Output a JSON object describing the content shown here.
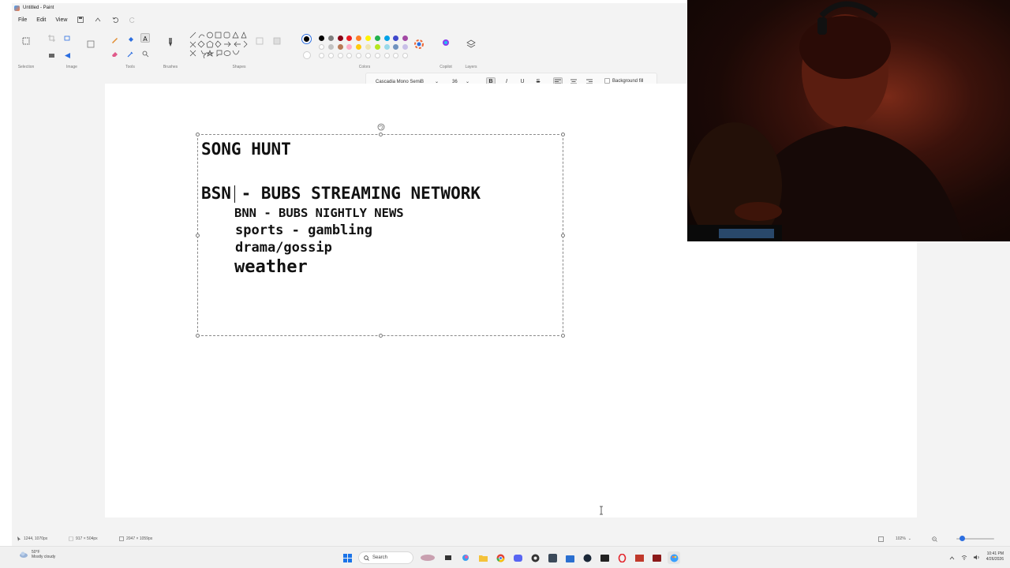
{
  "window": {
    "title": "Untitled - Paint"
  },
  "menu": {
    "file": "File",
    "edit": "Edit",
    "view": "View"
  },
  "ribbon": {
    "groups": {
      "selection": "Selection",
      "image": "Image",
      "tools": "Tools",
      "brushes": "Brushes",
      "shapes": "Shapes",
      "colors": "Colors",
      "copilot": "Copilot",
      "layers": "Layers"
    },
    "palette": [
      "#000000",
      "#7f7f7f",
      "#880015",
      "#ed1c24",
      "#ff7f27",
      "#fff200",
      "#22b14c",
      "#00a2e8",
      "#3f48cc",
      "#a349a4",
      "#ffffff",
      "#c3c3c3",
      "#b97a57",
      "#ffaec9",
      "#ffc90e",
      "#efe4b0",
      "#b5e61d",
      "#99d9ea",
      "#7092be",
      "#c8bfe7"
    ]
  },
  "textbar": {
    "font": "Cascadia Mono SemiB",
    "size": "36",
    "bold": "B",
    "italic": "I",
    "underline": "U",
    "strike": "S",
    "background_fill": "Background fill"
  },
  "canvas": {
    "lines": [
      "SONG HUNT",
      "BSN - BUBS STREAMING NETWORK",
      "BNN - BUBS NIGHTLY NEWS",
      "sports - gambling",
      "drama/gossip",
      "weather"
    ]
  },
  "status": {
    "cursor_pos": "1244, 1070px",
    "selection_size": "917 × 504px",
    "canvas_size": "2047 × 1059px",
    "zoom": "102%"
  },
  "taskbar": {
    "weather_temp": "50°F",
    "weather_desc": "Mostly cloudy",
    "search": "Search",
    "time": "10:41 PM",
    "date": "4/26/2026"
  },
  "colors": {
    "accent": "#2c6ee0",
    "text": "#111111"
  }
}
